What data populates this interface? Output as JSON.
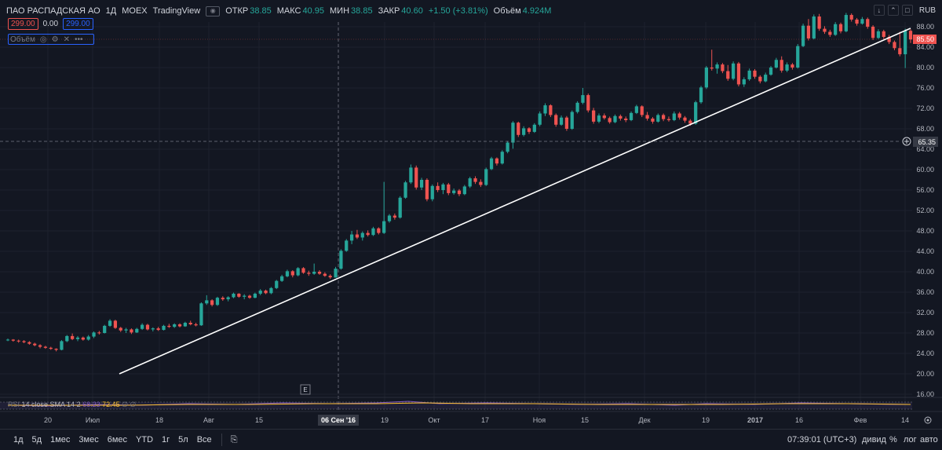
{
  "header": {
    "symbol": "ПАО РАСПАДСКАЯ АО",
    "interval": "1Д",
    "exchange": "MOEX",
    "source": "TradingView",
    "open_label": "ОТКР",
    "open_value": "38.85",
    "high_label": "МАКС",
    "high_value": "40.95",
    "low_label": "МИН",
    "low_value": "38.85",
    "close_label": "ЗАКР",
    "close_value": "40.60",
    "change": "+1.50 (+3.81%)",
    "volume_label": "Объём",
    "volume_value": "4.924M",
    "sell_price": "299.00",
    "spread": "0.00",
    "buy_price": "299.00",
    "volume_indicator_label": "Объём"
  },
  "top_right": {
    "currency": "RUB"
  },
  "price_axis": {
    "ticks": [
      "88.00",
      "84.00",
      "80.00",
      "76.00",
      "72.00",
      "68.00",
      "64.00",
      "60.00",
      "56.00",
      "52.00",
      "48.00",
      "44.00",
      "40.00",
      "36.00",
      "32.00",
      "28.00",
      "24.00",
      "20.00",
      "16.00"
    ],
    "current_price": "85.50",
    "crosshair_price": "65.35"
  },
  "time_axis": {
    "labels": [
      {
        "text": "20",
        "x": 61
      },
      {
        "text": "Июл",
        "x": 118
      },
      {
        "text": "18",
        "x": 203
      },
      {
        "text": "Авг",
        "x": 266
      },
      {
        "text": "15",
        "x": 330
      },
      {
        "text": "19",
        "x": 490
      },
      {
        "text": "Окт",
        "x": 553
      },
      {
        "text": "17",
        "x": 618
      },
      {
        "text": "Ноя",
        "x": 687
      },
      {
        "text": "15",
        "x": 745
      },
      {
        "text": "Дек",
        "x": 821
      },
      {
        "text": "19",
        "x": 899
      },
      {
        "text": "2017",
        "x": 962
      },
      {
        "text": "16",
        "x": 1018
      },
      {
        "text": "Фев",
        "x": 1096
      },
      {
        "text": "14",
        "x": 1153
      }
    ],
    "crosshair_date": "06 Сен '16"
  },
  "rsi": {
    "name": "RSI",
    "params": "14 close SMA 14 2",
    "value1": "68.23",
    "value2": "72.45",
    "suffix": "∅ ∅"
  },
  "bottom_bar": {
    "timeframes": [
      "1д",
      "5д",
      "1мес",
      "3мес",
      "6мес",
      "YTD",
      "1г",
      "5л",
      "Все"
    ],
    "time": "07:39:01 (UTC+3)",
    "dividends": "дивид",
    "percent": "%",
    "log": "лог",
    "auto": "авто"
  },
  "event_marker": "E",
  "colors": {
    "background": "#131722",
    "up": "#26a69a",
    "down": "#ef5350",
    "grid": "#1e222d",
    "trendline": "#ffffff",
    "rsi_line": "#7e57c2",
    "rsi_sma": "#fbc02d"
  },
  "chart_data": {
    "type": "candlestick",
    "y_axis": {
      "min": 16,
      "max": 88
    },
    "series": [
      {
        "o": 26.7,
        "h": 26.9,
        "l": 26.4,
        "c": 26.7
      },
      {
        "o": 26.7,
        "h": 26.8,
        "l": 26.3,
        "c": 26.5
      },
      {
        "o": 26.5,
        "h": 26.7,
        "l": 26.1,
        "c": 26.4
      },
      {
        "o": 26.4,
        "h": 26.6,
        "l": 26.0,
        "c": 26.2
      },
      {
        "o": 26.2,
        "h": 26.4,
        "l": 25.7,
        "c": 25.9
      },
      {
        "o": 25.9,
        "h": 26.1,
        "l": 25.4,
        "c": 25.6
      },
      {
        "o": 25.6,
        "h": 25.8,
        "l": 25.0,
        "c": 25.3
      },
      {
        "o": 25.3,
        "h": 25.5,
        "l": 24.9,
        "c": 25.1
      },
      {
        "o": 25.1,
        "h": 25.3,
        "l": 24.7,
        "c": 24.9
      },
      {
        "o": 24.9,
        "h": 25.0,
        "l": 24.4,
        "c": 24.7
      },
      {
        "o": 24.7,
        "h": 26.6,
        "l": 24.6,
        "c": 26.4
      },
      {
        "o": 26.4,
        "h": 27.6,
        "l": 26.2,
        "c": 27.4
      },
      {
        "o": 27.4,
        "h": 27.9,
        "l": 26.6,
        "c": 26.8
      },
      {
        "o": 26.8,
        "h": 27.4,
        "l": 26.4,
        "c": 27.1
      },
      {
        "o": 27.1,
        "h": 27.3,
        "l": 26.5,
        "c": 26.7
      },
      {
        "o": 26.7,
        "h": 27.6,
        "l": 26.5,
        "c": 27.3
      },
      {
        "o": 27.3,
        "h": 28.3,
        "l": 27.0,
        "c": 28.1
      },
      {
        "o": 28.1,
        "h": 28.4,
        "l": 27.7,
        "c": 28.0
      },
      {
        "o": 28.0,
        "h": 29.6,
        "l": 27.9,
        "c": 29.4
      },
      {
        "o": 29.4,
        "h": 30.7,
        "l": 29.2,
        "c": 30.4
      },
      {
        "o": 30.4,
        "h": 30.6,
        "l": 28.8,
        "c": 29.0
      },
      {
        "o": 29.0,
        "h": 29.2,
        "l": 28.2,
        "c": 28.5
      },
      {
        "o": 28.5,
        "h": 29.0,
        "l": 28.0,
        "c": 28.7
      },
      {
        "o": 28.7,
        "h": 28.9,
        "l": 27.8,
        "c": 28.1
      },
      {
        "o": 28.1,
        "h": 29.0,
        "l": 28.0,
        "c": 28.8
      },
      {
        "o": 28.8,
        "h": 29.9,
        "l": 28.6,
        "c": 29.6
      },
      {
        "o": 29.6,
        "h": 29.8,
        "l": 28.5,
        "c": 28.7
      },
      {
        "o": 28.7,
        "h": 29.1,
        "l": 28.3,
        "c": 28.9
      },
      {
        "o": 28.9,
        "h": 29.2,
        "l": 28.4,
        "c": 28.6
      },
      {
        "o": 28.6,
        "h": 29.6,
        "l": 28.5,
        "c": 29.4
      },
      {
        "o": 29.4,
        "h": 29.8,
        "l": 29.0,
        "c": 29.2
      },
      {
        "o": 29.2,
        "h": 29.9,
        "l": 29.0,
        "c": 29.7
      },
      {
        "o": 29.7,
        "h": 29.9,
        "l": 29.1,
        "c": 29.3
      },
      {
        "o": 29.3,
        "h": 30.2,
        "l": 29.2,
        "c": 30.0
      },
      {
        "o": 30.0,
        "h": 30.4,
        "l": 29.5,
        "c": 29.7
      },
      {
        "o": 29.7,
        "h": 30.0,
        "l": 29.3,
        "c": 29.5
      },
      {
        "o": 29.5,
        "h": 34.0,
        "l": 29.4,
        "c": 33.8
      },
      {
        "o": 33.8,
        "h": 35.4,
        "l": 33.5,
        "c": 34.4
      },
      {
        "o": 34.4,
        "h": 34.6,
        "l": 33.2,
        "c": 33.5
      },
      {
        "o": 33.5,
        "h": 35.1,
        "l": 33.3,
        "c": 34.9
      },
      {
        "o": 34.9,
        "h": 35.2,
        "l": 34.3,
        "c": 34.6
      },
      {
        "o": 34.6,
        "h": 35.2,
        "l": 34.2,
        "c": 35.0
      },
      {
        "o": 35.0,
        "h": 35.9,
        "l": 34.8,
        "c": 35.7
      },
      {
        "o": 35.7,
        "h": 35.8,
        "l": 34.9,
        "c": 35.1
      },
      {
        "o": 35.1,
        "h": 35.6,
        "l": 34.6,
        "c": 35.3
      },
      {
        "o": 35.3,
        "h": 35.5,
        "l": 34.7,
        "c": 34.9
      },
      {
        "o": 34.9,
        "h": 35.9,
        "l": 34.8,
        "c": 35.7
      },
      {
        "o": 35.7,
        "h": 36.6,
        "l": 35.4,
        "c": 36.3
      },
      {
        "o": 36.3,
        "h": 36.5,
        "l": 35.6,
        "c": 35.8
      },
      {
        "o": 35.8,
        "h": 37.0,
        "l": 35.6,
        "c": 36.8
      },
      {
        "o": 36.8,
        "h": 38.4,
        "l": 36.6,
        "c": 38.2
      },
      {
        "o": 38.2,
        "h": 39.4,
        "l": 38.0,
        "c": 39.1
      },
      {
        "o": 39.1,
        "h": 40.4,
        "l": 38.9,
        "c": 40.1
      },
      {
        "o": 40.1,
        "h": 40.3,
        "l": 38.9,
        "c": 39.3
      },
      {
        "o": 39.3,
        "h": 40.9,
        "l": 39.1,
        "c": 40.7
      },
      {
        "o": 40.7,
        "h": 40.9,
        "l": 39.6,
        "c": 39.8
      },
      {
        "o": 39.8,
        "h": 40.2,
        "l": 39.2,
        "c": 39.6
      },
      {
        "o": 39.6,
        "h": 41.6,
        "l": 39.4,
        "c": 40.0
      },
      {
        "o": 40.0,
        "h": 40.3,
        "l": 39.4,
        "c": 39.6
      },
      {
        "o": 39.6,
        "h": 39.9,
        "l": 39.0,
        "c": 39.2
      },
      {
        "o": 39.2,
        "h": 39.5,
        "l": 38.6,
        "c": 38.9
      },
      {
        "o": 38.85,
        "h": 40.95,
        "l": 38.85,
        "c": 40.6
      },
      {
        "o": 40.6,
        "h": 44.4,
        "l": 40.4,
        "c": 44.1
      },
      {
        "o": 44.1,
        "h": 46.4,
        "l": 43.9,
        "c": 46.1
      },
      {
        "o": 46.1,
        "h": 48.0,
        "l": 45.4,
        "c": 47.3
      },
      {
        "o": 47.3,
        "h": 48.2,
        "l": 46.4,
        "c": 46.7
      },
      {
        "o": 46.7,
        "h": 47.9,
        "l": 46.1,
        "c": 47.6
      },
      {
        "o": 47.6,
        "h": 48.1,
        "l": 46.9,
        "c": 47.2
      },
      {
        "o": 47.2,
        "h": 48.8,
        "l": 47.0,
        "c": 48.5
      },
      {
        "o": 48.5,
        "h": 48.7,
        "l": 47.3,
        "c": 47.6
      },
      {
        "o": 47.6,
        "h": 57.6,
        "l": 47.4,
        "c": 49.9
      },
      {
        "o": 49.9,
        "h": 51.3,
        "l": 49.6,
        "c": 51.0
      },
      {
        "o": 51.0,
        "h": 51.4,
        "l": 50.2,
        "c": 50.6
      },
      {
        "o": 50.6,
        "h": 54.8,
        "l": 50.4,
        "c": 54.5
      },
      {
        "o": 54.5,
        "h": 57.8,
        "l": 54.3,
        "c": 57.5
      },
      {
        "o": 57.5,
        "h": 61.0,
        "l": 57.2,
        "c": 60.4
      },
      {
        "o": 60.4,
        "h": 60.8,
        "l": 56.1,
        "c": 56.5
      },
      {
        "o": 56.5,
        "h": 58.4,
        "l": 56.0,
        "c": 58.0
      },
      {
        "o": 58.0,
        "h": 58.3,
        "l": 53.8,
        "c": 54.2
      },
      {
        "o": 54.2,
        "h": 57.1,
        "l": 53.8,
        "c": 56.8
      },
      {
        "o": 56.8,
        "h": 57.5,
        "l": 55.6,
        "c": 56.0
      },
      {
        "o": 56.0,
        "h": 57.4,
        "l": 55.2,
        "c": 57.1
      },
      {
        "o": 57.1,
        "h": 57.4,
        "l": 55.0,
        "c": 55.4
      },
      {
        "o": 55.4,
        "h": 56.3,
        "l": 55.1,
        "c": 55.9
      },
      {
        "o": 55.9,
        "h": 56.2,
        "l": 54.8,
        "c": 55.2
      },
      {
        "o": 55.2,
        "h": 57.0,
        "l": 55.0,
        "c": 56.7
      },
      {
        "o": 56.7,
        "h": 58.6,
        "l": 56.4,
        "c": 58.3
      },
      {
        "o": 58.3,
        "h": 58.7,
        "l": 57.2,
        "c": 57.6
      },
      {
        "o": 57.6,
        "h": 58.1,
        "l": 56.6,
        "c": 57.0
      },
      {
        "o": 57.0,
        "h": 60.4,
        "l": 56.8,
        "c": 60.1
      },
      {
        "o": 60.1,
        "h": 62.5,
        "l": 59.9,
        "c": 62.2
      },
      {
        "o": 62.2,
        "h": 62.4,
        "l": 60.8,
        "c": 61.2
      },
      {
        "o": 61.2,
        "h": 63.8,
        "l": 61.0,
        "c": 63.5
      },
      {
        "o": 63.5,
        "h": 65.6,
        "l": 63.2,
        "c": 65.3
      },
      {
        "o": 65.3,
        "h": 69.5,
        "l": 64.1,
        "c": 69.2
      },
      {
        "o": 69.2,
        "h": 69.4,
        "l": 66.4,
        "c": 66.8
      },
      {
        "o": 66.8,
        "h": 68.5,
        "l": 66.5,
        "c": 68.1
      },
      {
        "o": 68.1,
        "h": 68.3,
        "l": 67.0,
        "c": 67.4
      },
      {
        "o": 67.4,
        "h": 69.1,
        "l": 67.2,
        "c": 68.8
      },
      {
        "o": 68.8,
        "h": 71.4,
        "l": 68.5,
        "c": 71.0
      },
      {
        "o": 71.0,
        "h": 73.0,
        "l": 70.5,
        "c": 72.6
      },
      {
        "o": 72.6,
        "h": 72.8,
        "l": 70.3,
        "c": 70.7
      },
      {
        "o": 70.7,
        "h": 71.0,
        "l": 68.4,
        "c": 68.8
      },
      {
        "o": 68.8,
        "h": 70.6,
        "l": 68.6,
        "c": 70.2
      },
      {
        "o": 70.2,
        "h": 70.5,
        "l": 67.6,
        "c": 68.0
      },
      {
        "o": 68.0,
        "h": 71.6,
        "l": 67.8,
        "c": 71.3
      },
      {
        "o": 71.3,
        "h": 73.4,
        "l": 71.0,
        "c": 73.1
      },
      {
        "o": 73.1,
        "h": 76.0,
        "l": 72.8,
        "c": 74.6
      },
      {
        "o": 74.6,
        "h": 74.9,
        "l": 71.2,
        "c": 71.6
      },
      {
        "o": 71.6,
        "h": 72.1,
        "l": 69.0,
        "c": 69.4
      },
      {
        "o": 69.4,
        "h": 71.0,
        "l": 69.1,
        "c": 70.6
      },
      {
        "o": 70.6,
        "h": 71.0,
        "l": 69.8,
        "c": 70.1
      },
      {
        "o": 70.1,
        "h": 70.4,
        "l": 69.0,
        "c": 69.3
      },
      {
        "o": 69.3,
        "h": 70.8,
        "l": 69.1,
        "c": 70.5
      },
      {
        "o": 70.5,
        "h": 70.8,
        "l": 69.6,
        "c": 70.0
      },
      {
        "o": 70.0,
        "h": 70.4,
        "l": 69.3,
        "c": 69.7
      },
      {
        "o": 69.7,
        "h": 71.4,
        "l": 69.5,
        "c": 71.1
      },
      {
        "o": 71.1,
        "h": 72.7,
        "l": 70.9,
        "c": 72.4
      },
      {
        "o": 72.4,
        "h": 72.6,
        "l": 70.3,
        "c": 70.7
      },
      {
        "o": 70.7,
        "h": 71.3,
        "l": 69.6,
        "c": 70.0
      },
      {
        "o": 70.0,
        "h": 70.3,
        "l": 69.0,
        "c": 69.4
      },
      {
        "o": 69.4,
        "h": 71.0,
        "l": 69.2,
        "c": 70.7
      },
      {
        "o": 70.7,
        "h": 71.0,
        "l": 69.5,
        "c": 69.9
      },
      {
        "o": 69.9,
        "h": 70.4,
        "l": 69.4,
        "c": 69.7
      },
      {
        "o": 69.7,
        "h": 71.4,
        "l": 69.5,
        "c": 71.0
      },
      {
        "o": 71.0,
        "h": 71.3,
        "l": 69.8,
        "c": 70.2
      },
      {
        "o": 70.2,
        "h": 70.5,
        "l": 69.2,
        "c": 69.6
      },
      {
        "o": 69.6,
        "h": 69.9,
        "l": 68.6,
        "c": 69.0
      },
      {
        "o": 69.0,
        "h": 73.5,
        "l": 68.8,
        "c": 73.2
      },
      {
        "o": 73.2,
        "h": 76.4,
        "l": 72.9,
        "c": 76.1
      },
      {
        "o": 76.1,
        "h": 80.3,
        "l": 75.8,
        "c": 80.0
      },
      {
        "o": 80.0,
        "h": 83.5,
        "l": 79.4,
        "c": 79.8
      },
      {
        "o": 79.8,
        "h": 81.0,
        "l": 78.8,
        "c": 80.6
      },
      {
        "o": 80.6,
        "h": 80.9,
        "l": 78.9,
        "c": 79.3
      },
      {
        "o": 79.3,
        "h": 80.5,
        "l": 77.4,
        "c": 77.8
      },
      {
        "o": 77.8,
        "h": 81.2,
        "l": 77.5,
        "c": 80.8
      },
      {
        "o": 80.8,
        "h": 81.1,
        "l": 76.3,
        "c": 76.7
      },
      {
        "o": 76.7,
        "h": 78.1,
        "l": 76.2,
        "c": 77.7
      },
      {
        "o": 77.7,
        "h": 79.8,
        "l": 77.4,
        "c": 79.4
      },
      {
        "o": 79.4,
        "h": 79.7,
        "l": 77.8,
        "c": 78.2
      },
      {
        "o": 78.2,
        "h": 78.5,
        "l": 76.9,
        "c": 77.3
      },
      {
        "o": 77.3,
        "h": 79.0,
        "l": 77.1,
        "c": 78.6
      },
      {
        "o": 78.6,
        "h": 80.3,
        "l": 78.4,
        "c": 80.0
      },
      {
        "o": 80.0,
        "h": 81.9,
        "l": 79.8,
        "c": 81.5
      },
      {
        "o": 81.5,
        "h": 82.2,
        "l": 79.0,
        "c": 79.4
      },
      {
        "o": 79.4,
        "h": 81.0,
        "l": 79.1,
        "c": 80.6
      },
      {
        "o": 80.6,
        "h": 80.9,
        "l": 79.6,
        "c": 80.0
      },
      {
        "o": 80.0,
        "h": 84.6,
        "l": 79.8,
        "c": 84.2
      },
      {
        "o": 84.2,
        "h": 88.6,
        "l": 84.0,
        "c": 88.2
      },
      {
        "o": 88.2,
        "h": 89.5,
        "l": 85.3,
        "c": 85.7
      },
      {
        "o": 85.7,
        "h": 90.4,
        "l": 85.5,
        "c": 90.0
      },
      {
        "o": 90.0,
        "h": 90.5,
        "l": 87.2,
        "c": 87.6
      },
      {
        "o": 87.6,
        "h": 88.1,
        "l": 86.6,
        "c": 87.0
      },
      {
        "o": 87.0,
        "h": 87.4,
        "l": 86.0,
        "c": 86.4
      },
      {
        "o": 86.4,
        "h": 88.9,
        "l": 86.2,
        "c": 88.5
      },
      {
        "o": 88.5,
        "h": 88.8,
        "l": 86.7,
        "c": 87.1
      },
      {
        "o": 87.1,
        "h": 90.7,
        "l": 86.9,
        "c": 90.3
      },
      {
        "o": 90.3,
        "h": 90.6,
        "l": 89.0,
        "c": 89.4
      },
      {
        "o": 89.4,
        "h": 89.7,
        "l": 88.2,
        "c": 88.6
      },
      {
        "o": 88.6,
        "h": 89.9,
        "l": 88.4,
        "c": 89.5
      },
      {
        "o": 89.5,
        "h": 89.8,
        "l": 87.6,
        "c": 88.0
      },
      {
        "o": 88.0,
        "h": 88.3,
        "l": 85.4,
        "c": 85.8
      },
      {
        "o": 85.8,
        "h": 87.5,
        "l": 85.6,
        "c": 87.1
      },
      {
        "o": 87.1,
        "h": 87.4,
        "l": 85.6,
        "c": 86.0
      },
      {
        "o": 86.0,
        "h": 86.4,
        "l": 84.6,
        "c": 85.0
      },
      {
        "o": 85.0,
        "h": 85.3,
        "l": 83.4,
        "c": 83.8
      },
      {
        "o": 83.8,
        "h": 87.0,
        "l": 82.2,
        "c": 82.6
      },
      {
        "o": 82.6,
        "h": 87.6,
        "l": 79.9,
        "c": 87.2
      },
      {
        "o": 87.2,
        "h": 87.5,
        "l": 84.8,
        "c": 85.5
      }
    ]
  }
}
